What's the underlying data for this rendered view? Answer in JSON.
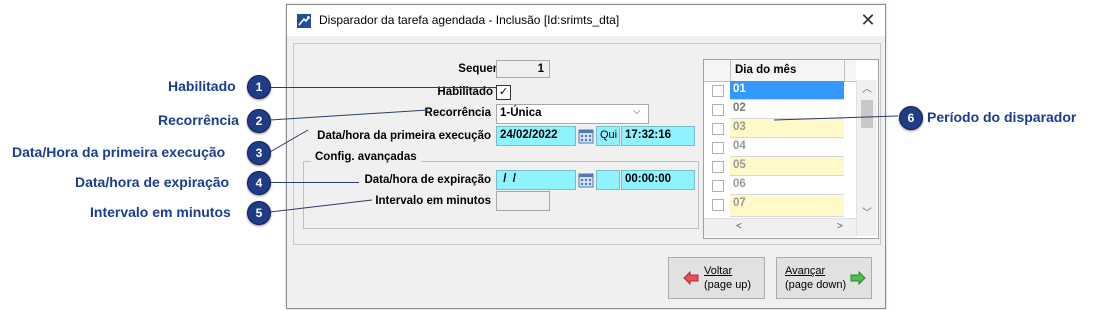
{
  "window": {
    "title": "Disparador da tarefa agendada - Inclusão [Id:srimts_dta]"
  },
  "form": {
    "sequencial_label": "Sequencial",
    "sequencial_value": "1",
    "habilitado_label": "Habilitado",
    "habilitado_checked": "✓",
    "recorrencia_label": "Recorrência",
    "recorrencia_value": "1-Única",
    "primeira_label": "Data/hora da primeira execução",
    "primeira_date": "24/02/2022",
    "primeira_day": "Qui",
    "primeira_time": "17:32:16",
    "group_title": "Config. avançadas",
    "expiracao_label": "Data/hora de expiração",
    "expiracao_date": " /  /",
    "expiracao_time": "00:00:00",
    "intervalo_label": "Intervalo em minutos",
    "intervalo_value": ""
  },
  "grid": {
    "header": "Dia do mês",
    "rows": [
      "01",
      "02",
      "03",
      "04",
      "05",
      "06",
      "07"
    ]
  },
  "buttons": {
    "voltar_line1": "Voltar",
    "voltar_line2": "(page up)",
    "avancar_line1": "Avançar",
    "avancar_line2": "(page down)"
  },
  "callouts": [
    {
      "num": "1",
      "label": "Habilitado"
    },
    {
      "num": "2",
      "label": "Recorrência"
    },
    {
      "num": "3",
      "label": "Data/Hora da primeira execução"
    },
    {
      "num": "4",
      "label": "Data/hora de expiração"
    },
    {
      "num": "5",
      "label": "Intervalo em minutos"
    },
    {
      "num": "6",
      "label": "Período do disparador"
    }
  ],
  "colors": {
    "callout_badge": "#1f3d86",
    "highlight_field": "#8ff3ff",
    "selected_row": "#3399ff",
    "odd_row": "#fff8c8"
  }
}
